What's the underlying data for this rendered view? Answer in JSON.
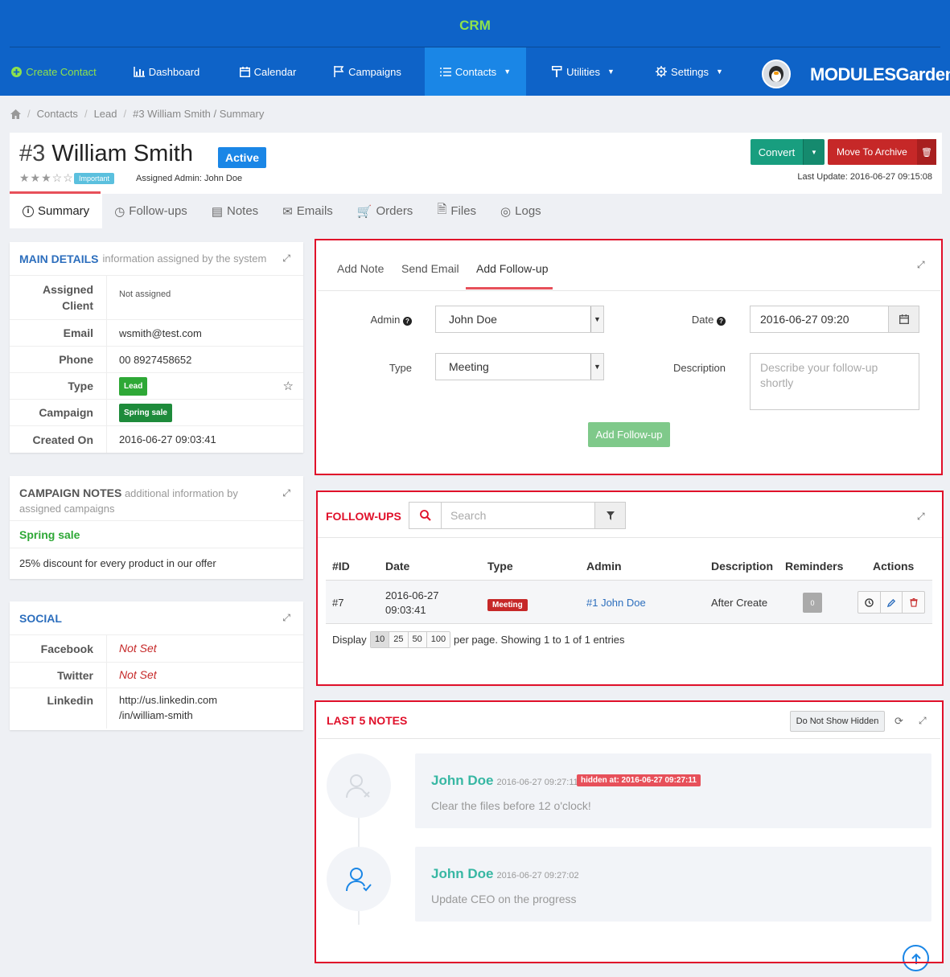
{
  "header": {
    "title": "CRM"
  },
  "nav": {
    "create_contact": "Create Contact",
    "dashboard": "Dashboard",
    "calendar": "Calendar",
    "campaigns": "Campaigns",
    "contacts": "Contacts",
    "utilities": "Utilities",
    "settings": "Settings",
    "brand": "MODULESGarden"
  },
  "breadcrumb": [
    "Contacts",
    "Lead",
    "#3 William Smith / Summary"
  ],
  "contact": {
    "id": "#3",
    "name": "William Smith",
    "status": "Active",
    "rating_label": "Important",
    "rating": 3,
    "rating_max": 5,
    "assigned_admin": "Assigned Admin: John Doe",
    "last_update": "Last Update: 2016-06-27 09:15:08"
  },
  "actions": {
    "convert": "Convert",
    "archive": "Move To Archive"
  },
  "tabs": [
    "Summary",
    "Follow-ups",
    "Notes",
    "Emails",
    "Orders",
    "Files",
    "Logs"
  ],
  "main_details": {
    "title": "MAIN DETAILS",
    "subtitle": "information assigned by the system",
    "rows": [
      {
        "k": "Assigned Client",
        "v": "Not assigned"
      },
      {
        "k": "Email",
        "v": "wsmith@test.com"
      },
      {
        "k": "Phone",
        "v": "00 8927458652"
      },
      {
        "k": "Type",
        "v": "Lead"
      },
      {
        "k": "Campaign",
        "v": "Spring sale"
      },
      {
        "k": "Created On",
        "v": "2016-06-27 09:03:41"
      }
    ]
  },
  "campaign_notes": {
    "title": "CAMPAIGN NOTES",
    "subtitle": "additional information by assigned campaigns",
    "name": "Spring sale",
    "text": "25% discount for every product in our offer"
  },
  "social": {
    "title": "SOCIAL",
    "rows": [
      {
        "k": "Facebook",
        "v": "Not Set"
      },
      {
        "k": "Twitter",
        "v": "Not Set"
      },
      {
        "k": "Linkedin",
        "v": "http://us.linkedin.com /in/william-smith"
      }
    ]
  },
  "form": {
    "tabs": [
      "Add Note",
      "Send Email",
      "Add Follow-up"
    ],
    "admin_label": "Admin",
    "admin_value": "John Doe",
    "date_label": "Date",
    "date_value": "2016-06-27 09:20",
    "type_label": "Type",
    "type_value": "Meeting",
    "desc_label": "Description",
    "desc_placeholder": "Describe your follow-up shortly",
    "submit": "Add Follow-up"
  },
  "followups": {
    "title": "FOLLOW-UPS",
    "search_placeholder": "Search",
    "columns": [
      "#ID",
      "Date",
      "Type",
      "Admin",
      "Description",
      "Reminders",
      "Actions"
    ],
    "row": {
      "id": "#7",
      "date": "2016-06-27 09:03:41",
      "type": "Meeting",
      "admin": "#1 John Doe",
      "description": "After Create",
      "reminders": "0"
    },
    "display": "Display",
    "page_sizes": [
      "10",
      "25",
      "50",
      "100"
    ],
    "summary": "per page. Showing 1 to 1 of 1 entries"
  },
  "notes": {
    "title": "LAST 5 NOTES",
    "hidden_btn": "Do Not Show Hidden",
    "items": [
      {
        "author": "John Doe",
        "time": "2016-06-27 09:27:11",
        "hidden": "hidden at: 2016-06-27 09:27:11",
        "text": "Clear the files before 12 o'clock!"
      },
      {
        "author": "John Doe",
        "time": "2016-06-27 09:27:02",
        "text": "Update CEO on the progress"
      }
    ]
  },
  "colors": {
    "header": "#0e63c8",
    "active_nav": "#1a86e6",
    "accent_green": "#8ee24c",
    "danger": "#c62828",
    "teal": "#189e7f"
  }
}
